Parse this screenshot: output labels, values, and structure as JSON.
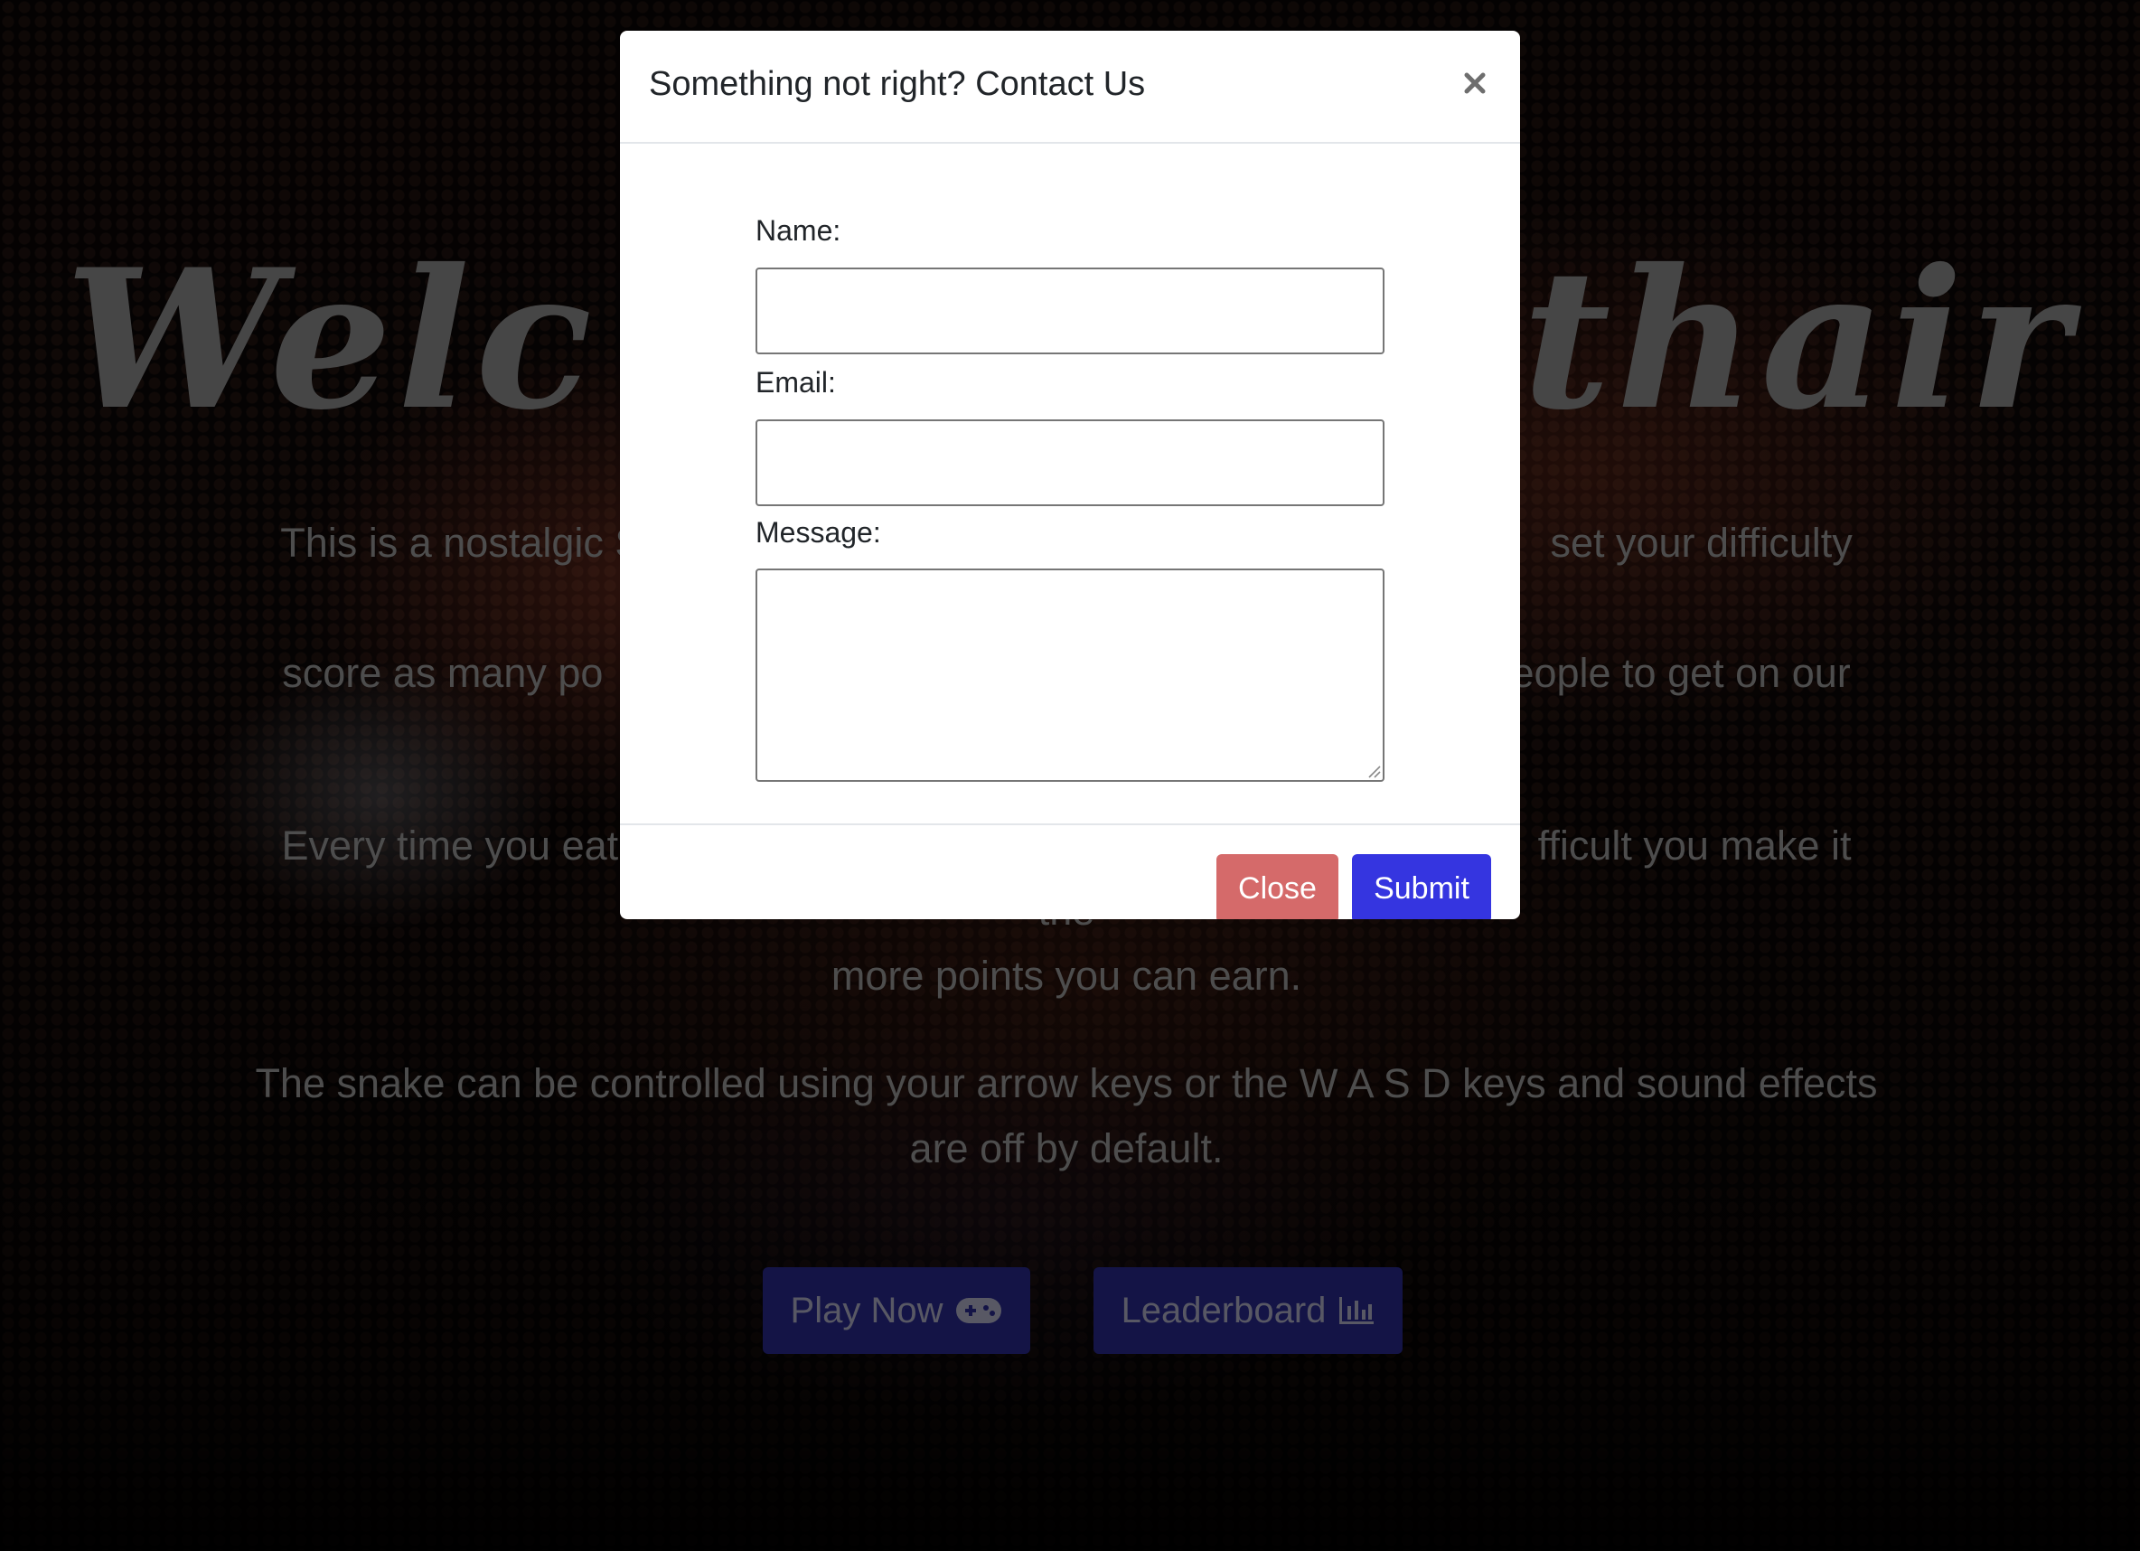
{
  "page": {
    "hero_title_left": "Welc",
    "hero_title_right": "athair",
    "paragraph_1_line_1_left": "This is a nostalgic Sn",
    "paragraph_1_line_1_right": "set your difficulty and",
    "paragraph_1_line_2_left": "score as many po",
    "paragraph_1_line_2_right": "people to get on our",
    "paragraph_2_line_1_left": "Every time you eat a",
    "paragraph_2_line_1_right": "fficult you make it the",
    "paragraph_2_line_2": "more points you can earn.",
    "paragraph_3": "The snake can be controlled using your arrow keys or the W A S D keys and sound effects are off by default.",
    "play_button_label": "Play Now",
    "leaderboard_button_label": "Leaderboard"
  },
  "modal": {
    "title": "Something not right? Contact Us",
    "close_symbol": "×",
    "fields": {
      "name_label": "Name:",
      "name_value": "",
      "email_label": "Email:",
      "email_value": "",
      "message_label": "Message:",
      "message_value": ""
    },
    "buttons": {
      "close_label": "Close",
      "submit_label": "Submit"
    }
  },
  "colors": {
    "overlay": "rgba(0,0,0,0.5)",
    "close_button": "#d56a6a",
    "submit_button": "#3535e0",
    "hero_button": "#28288d",
    "hero_text": "#9a9a9a"
  },
  "icons": {
    "play": "gamepad-icon",
    "leaderboard": "bar-chart-icon",
    "modal_close": "close-icon"
  }
}
